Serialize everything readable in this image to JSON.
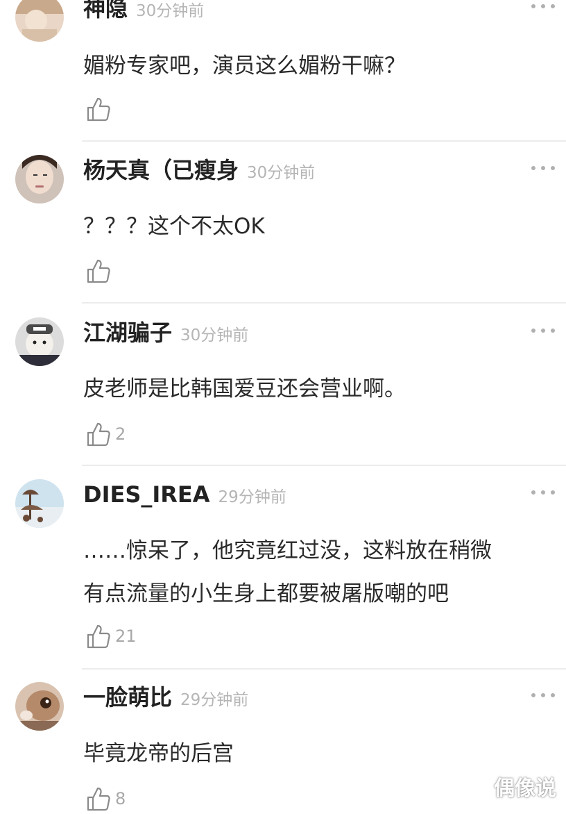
{
  "comments": [
    {
      "username": "神隐",
      "time": "30分钟前",
      "lines": [
        "媚粉专家吧，演员这么媚粉干嘛？"
      ],
      "likes": ""
    },
    {
      "username": "杨天真（已瘦身",
      "time": "30分钟前",
      "lines": [
        "？？？这个不太OK"
      ],
      "likes": ""
    },
    {
      "username": "江湖骗子",
      "time": "30分钟前",
      "lines": [
        "皮老师是比韩国爱豆还会营业啊。"
      ],
      "likes": "2"
    },
    {
      "username": "DIES_IREA",
      "time": "29分钟前",
      "lines": [
        "……惊呆了，他究竟红过没，这料放在稍微",
        "有点流量的小生身上都要被屠版嘲的吧"
      ],
      "likes": "21"
    },
    {
      "username": "一脸萌比",
      "time": "29分钟前",
      "lines": [
        "毕竟龙帝的后宫"
      ],
      "likes": "8"
    }
  ],
  "watermark": "偶像说",
  "icons": {
    "like": "thumbs-up-icon",
    "more": "more-dots-icon"
  },
  "colors": {
    "username": "#222222",
    "timestamp": "#b5b5b5",
    "divider": "#ececec"
  }
}
